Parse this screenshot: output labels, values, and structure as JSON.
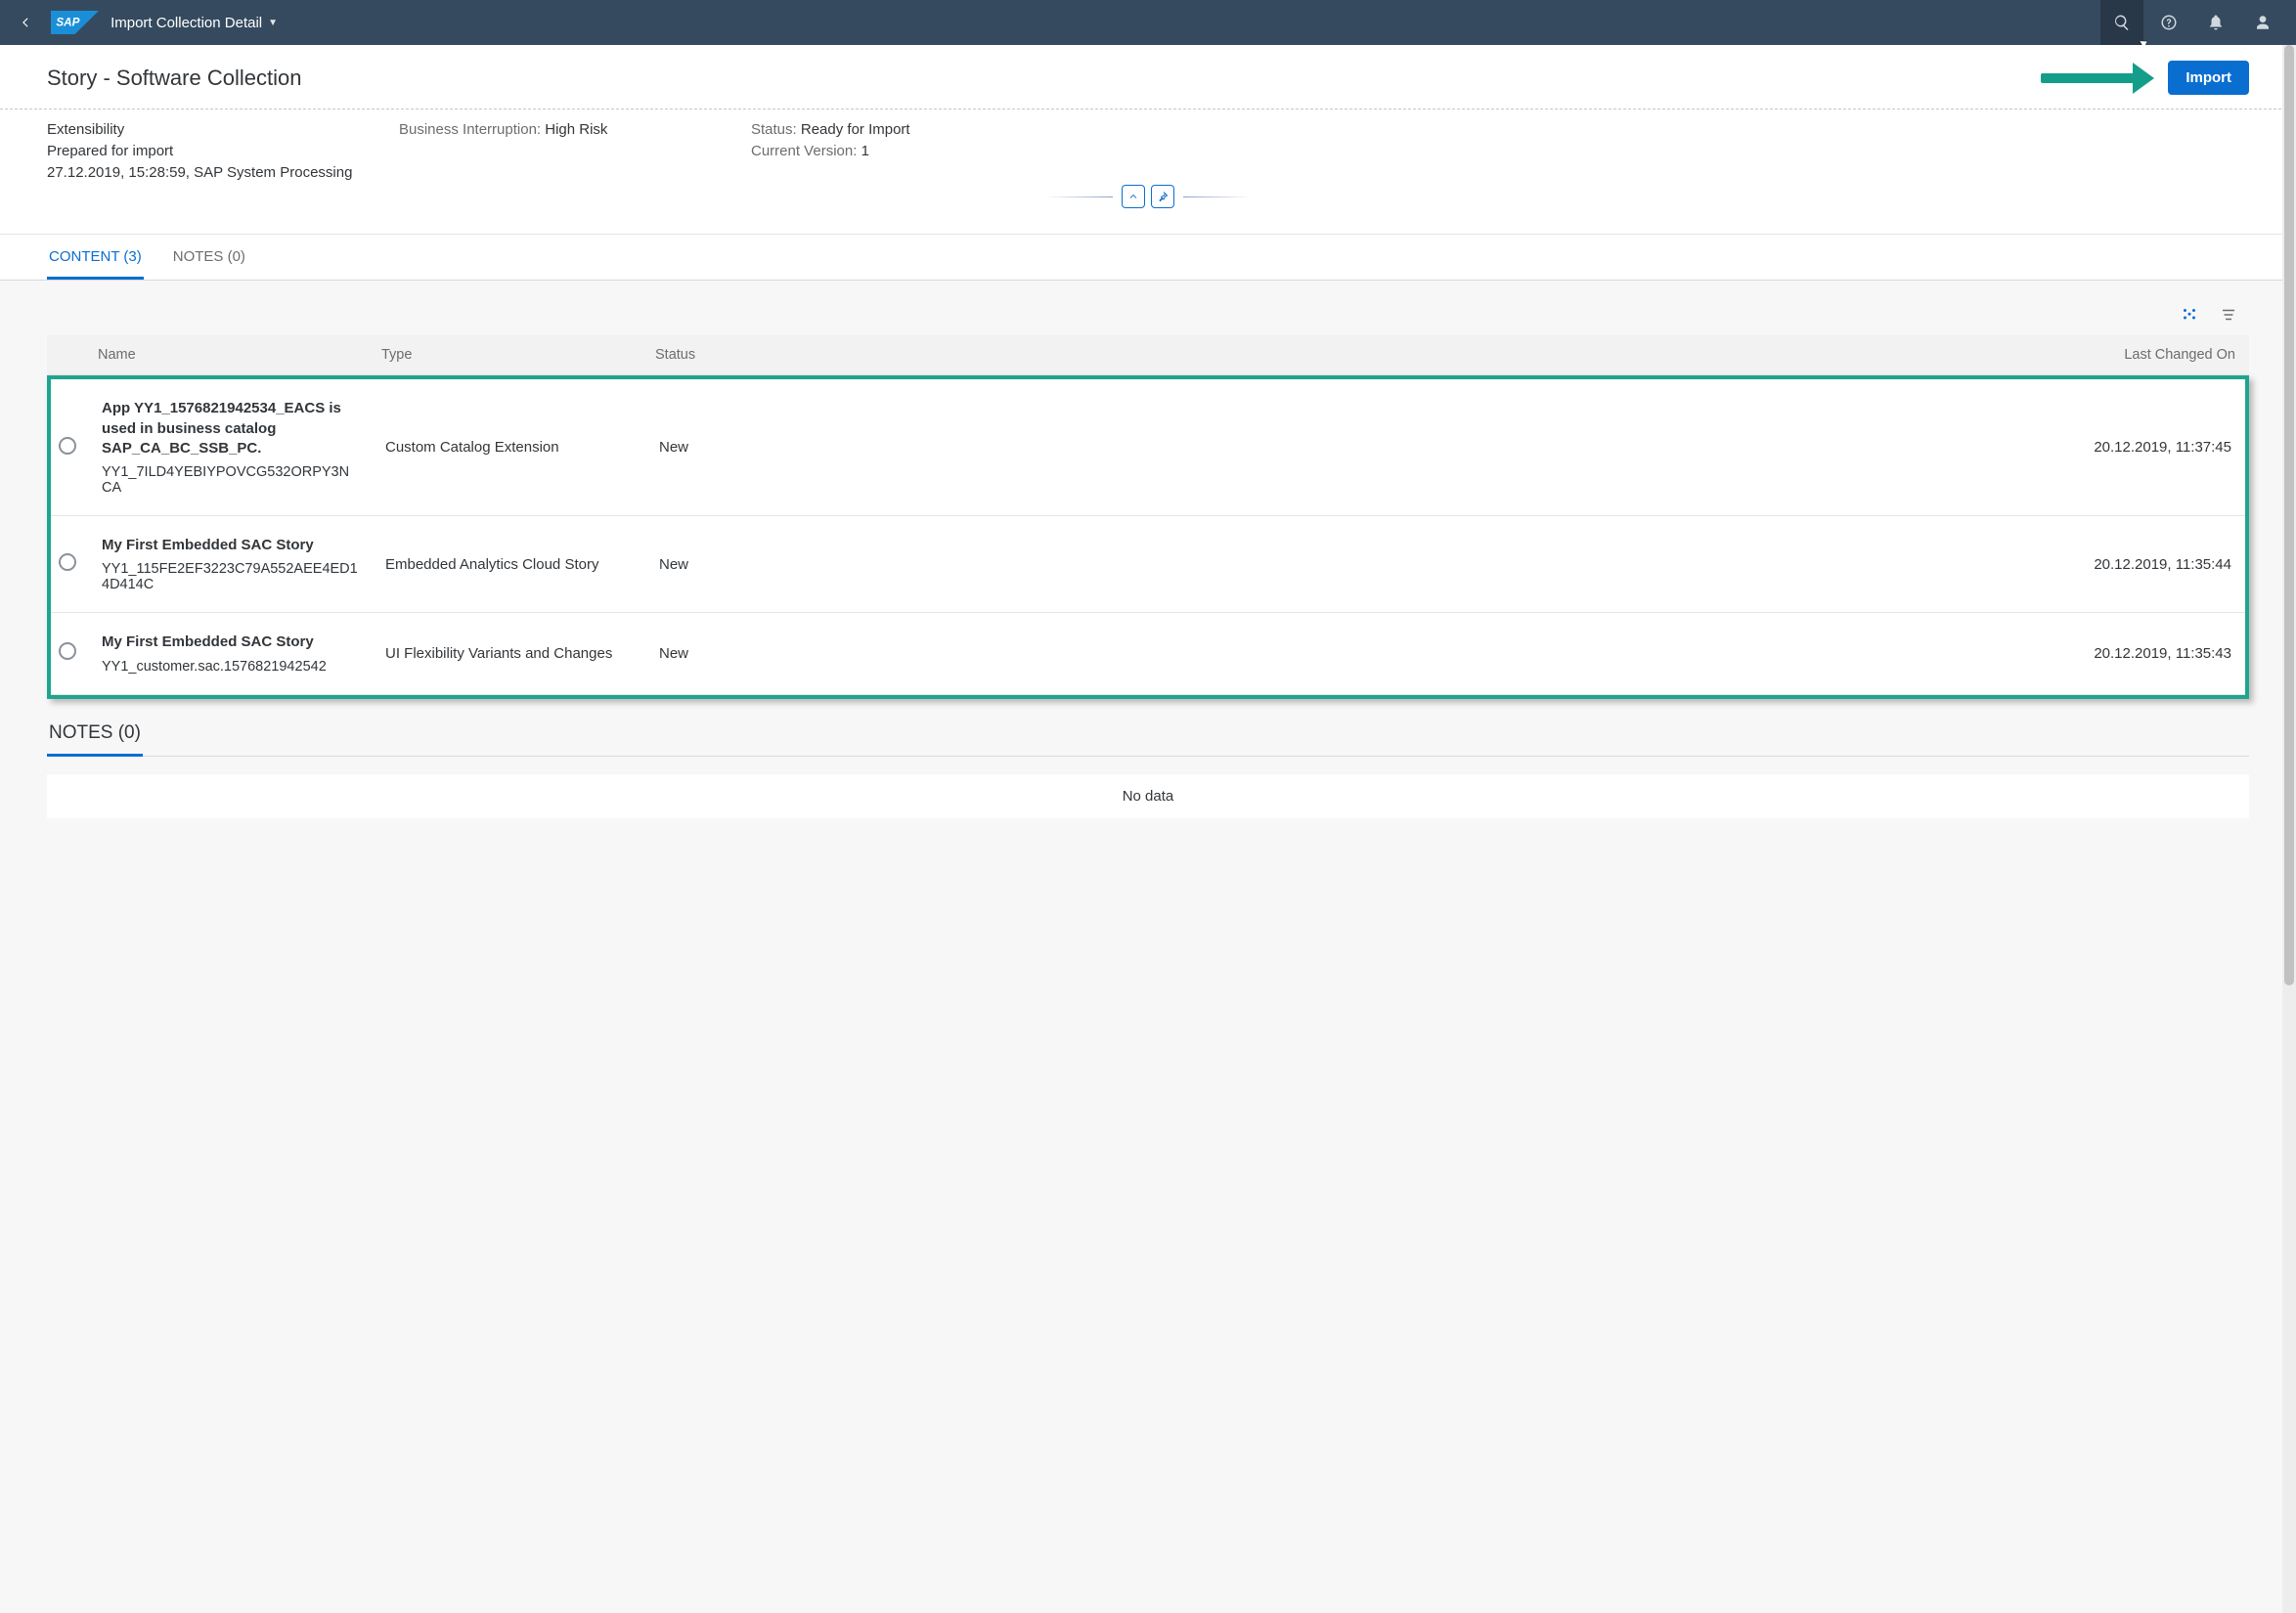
{
  "shell": {
    "title": "Import Collection Detail"
  },
  "header": {
    "page_title": "Story - Software Collection",
    "import_label": "Import"
  },
  "info": {
    "extensibility": "Extensibility",
    "prepared": "Prepared for import",
    "timestamp": "27.12.2019, 15:28:59, SAP System Processing",
    "interruption_label": "Business Interruption:",
    "interruption_value": "High Risk",
    "status_label": "Status:",
    "status_value": "Ready for Import",
    "version_label": "Current Version:",
    "version_value": "1"
  },
  "tabs": {
    "content": "CONTENT (3)",
    "notes": "NOTES (0)"
  },
  "table": {
    "columns": {
      "name": "Name",
      "type": "Type",
      "status": "Status",
      "last_changed": "Last Changed On"
    },
    "rows": [
      {
        "title": "App YY1_1576821942534_EACS is used in business catalog SAP_CA_BC_SSB_PC.",
        "sub": "YY1_7ILD4YEBIYPOVCG532ORPY3NCA",
        "type": "Custom Catalog Extension",
        "status": "New",
        "changed": "20.12.2019, 11:37:45"
      },
      {
        "title": "My First Embedded SAC Story",
        "sub": "YY1_115FE2EF3223C79A552AEE4ED14D414C",
        "type": "Embedded Analytics Cloud Story",
        "status": "New",
        "changed": "20.12.2019, 11:35:44"
      },
      {
        "title": "My First Embedded SAC Story",
        "sub": "YY1_customer.sac.1576821942542",
        "type": "UI Flexibility Variants and Changes",
        "status": "New",
        "changed": "20.12.2019, 11:35:43"
      }
    ]
  },
  "notes": {
    "heading": "NOTES (0)",
    "no_data": "No data"
  }
}
